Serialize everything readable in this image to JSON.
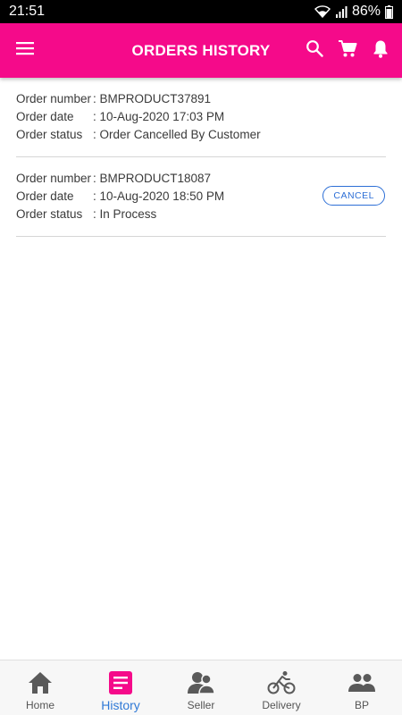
{
  "status_bar": {
    "time": "21:51",
    "battery": "86%",
    "icons": [
      "wifi-icon",
      "signal-icon",
      "battery-icon"
    ]
  },
  "app_bar": {
    "title": "ORDERS HISTORY",
    "left_icon": "menu-icon",
    "actions": [
      "search-icon",
      "cart-icon",
      "bell-icon"
    ],
    "color": "#f50a8a"
  },
  "orders": [
    {
      "number_label": "Order number",
      "number": ": BMPRODUCT37891",
      "date_label": "Order date",
      "date": ": 10-Aug-2020 17:03 PM",
      "status_label": "Order status",
      "status": ": Order Cancelled By Customer"
    },
    {
      "number_label": "Order number",
      "number": ": BMPRODUCT18087",
      "date_label": "Order date",
      "date": ": 10-Aug-2020 18:50 PM",
      "status_label": "Order status",
      "status": ": In Process",
      "action_label": "CANCEL"
    }
  ],
  "bottom_nav": {
    "items": [
      {
        "label": "Home",
        "icon": "home-icon"
      },
      {
        "label": "History",
        "icon": "history-icon",
        "active": true
      },
      {
        "label": "Seller",
        "icon": "seller-icon"
      },
      {
        "label": "Delivery",
        "icon": "bicycle-icon"
      },
      {
        "label": "BP",
        "icon": "people-icon"
      }
    ],
    "active_color": "#2f79d6",
    "active_icon_color": "#f50a8a"
  }
}
